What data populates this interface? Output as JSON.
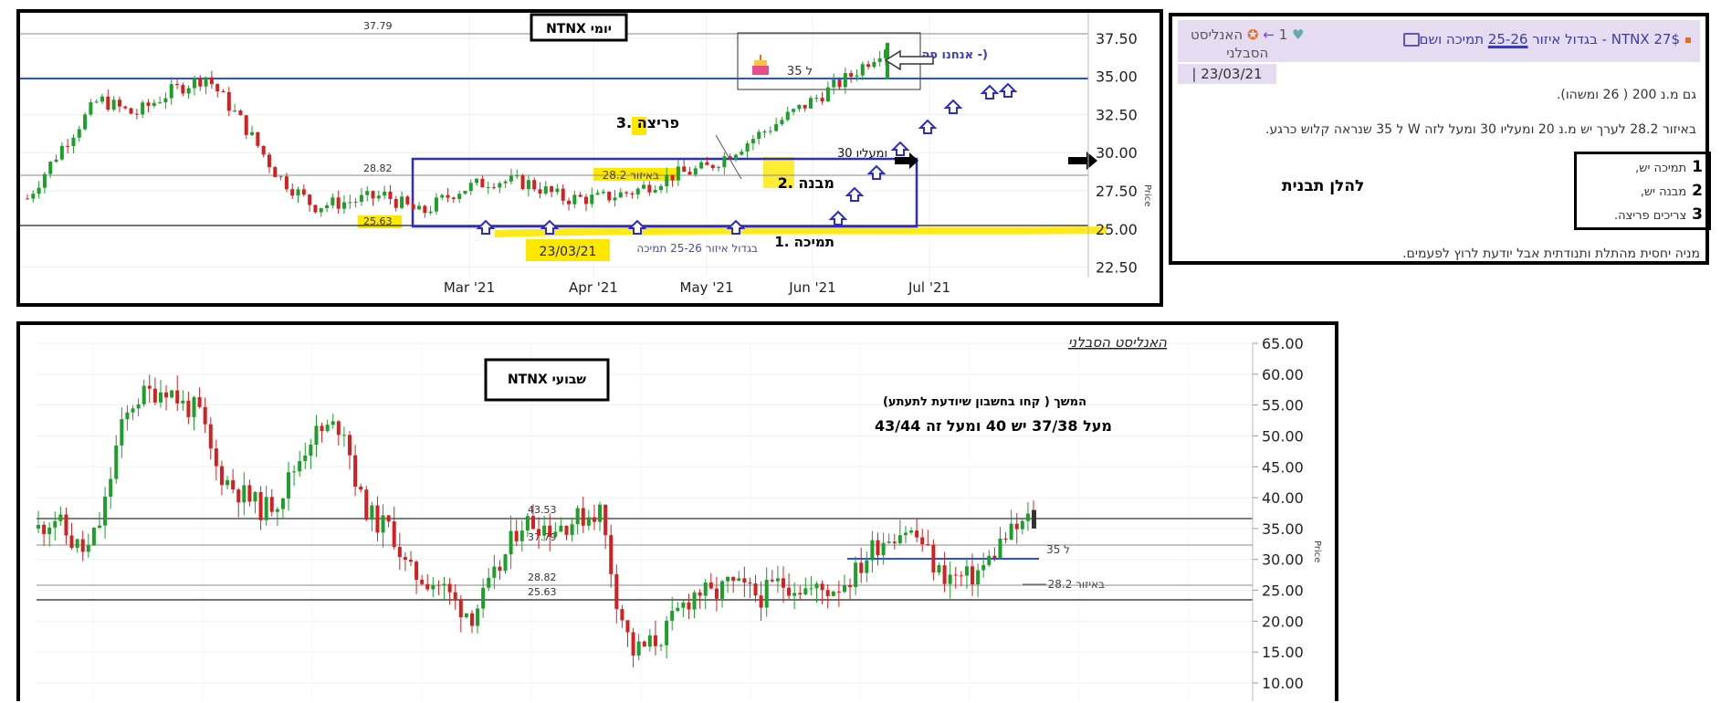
{
  "daily": {
    "title": "NTNX יומי",
    "y_ticks": [
      "37.50",
      "35.00",
      "32.50",
      "30.00",
      "27.50",
      "25.00",
      "22.50"
    ],
    "x_ticks": [
      "Mar '21",
      "Apr '21",
      "May '21",
      "Jun '21",
      "Jul '21"
    ],
    "ref_levels": [
      "37.79",
      "28.82",
      "25.63"
    ],
    "labels": {
      "breakout": "3. פריצה",
      "pattern": "2. מבנה",
      "support": "1. תמיכה",
      "here": "אנחנו פה -)",
      "to35": "ל 35",
      "above30": "ומעליו 30",
      "zone282": "באיזור 28.2",
      "zone_support": "בגדול איזור 25-26 תמיכה",
      "date": "23/03/21",
      "price_axis": "Price"
    },
    "colors": {
      "up": "#1e9e2a",
      "down": "#d42020",
      "level": "#2b50e8",
      "highlight": "#ffe800",
      "box": "#2b2bd0"
    },
    "chart_data": {
      "type": "candlestick",
      "x": [
        "2021-02-01",
        "2021-02-05",
        "2021-02-10",
        "2021-02-15",
        "2021-02-20",
        "2021-02-25",
        "2021-03-01",
        "2021-03-05",
        "2021-03-10",
        "2021-03-15",
        "2021-03-20",
        "2021-03-25",
        "2021-04-01",
        "2021-04-07",
        "2021-04-14",
        "2021-04-21",
        "2021-04-28",
        "2021-05-05",
        "2021-05-12",
        "2021-05-19",
        "2021-05-26",
        "2021-06-02",
        "2021-06-09",
        "2021-06-16",
        "2021-06-21"
      ],
      "close": [
        27.0,
        30.5,
        33.5,
        32.5,
        34.0,
        35.0,
        32.0,
        28.5,
        26.5,
        26.8,
        27.2,
        26.0,
        27.5,
        28.2,
        28.0,
        27.0,
        27.0,
        27.5,
        28.5,
        29.0,
        30.5,
        32.0,
        33.5,
        35.0,
        37.0
      ],
      "ylim": [
        22.5,
        38.5
      ],
      "xlabel": "",
      "ylabel": "Price"
    }
  },
  "weekly": {
    "title": "NTNX שבועי",
    "signature": "האנליסט הסבלני",
    "y_ticks": [
      "65.00",
      "60.00",
      "55.00",
      "50.00",
      "45.00",
      "40.00",
      "35.00",
      "30.00",
      "25.00",
      "20.00",
      "15.00",
      "10.00"
    ],
    "ref_levels": [
      "43.53",
      "37.79",
      "28.82",
      "25.63"
    ],
    "labels": {
      "continue": "המשך  ( קחו בחשבון שיודעת לתעתע)",
      "targets": "מעל  37/38  יש 40 ומעל זה 43/44",
      "to35": "ל 35",
      "zone282": "באיזור 28.2",
      "price_axis": "Price"
    },
    "chart_data": {
      "type": "candlestick",
      "close": [
        35,
        37,
        33,
        31,
        37,
        50,
        56,
        57,
        58,
        55,
        54,
        45,
        42,
        40,
        38,
        40,
        45,
        50,
        51,
        52,
        40,
        36,
        35,
        28,
        27,
        26,
        23,
        21,
        25,
        30,
        36,
        36,
        35,
        36,
        37,
        38,
        24,
        15,
        16,
        18,
        22,
        25,
        24,
        26,
        25,
        24,
        26,
        26,
        25,
        25,
        26,
        28,
        32,
        34,
        35,
        33,
        28,
        27,
        27,
        29,
        33,
        35,
        37
      ],
      "ylim": [
        8,
        67
      ],
      "xlabel": "",
      "ylabel": "Price"
    }
  },
  "post": {
    "title_pre": "NTNX 27$ - בגדול איזור ",
    "title_hl": "25-26",
    "title_post": " תמיכה ושם",
    "author_line1": "האנליסט",
    "author_line2": "הסבלני",
    "likes": "1",
    "date": "23/03/21 |",
    "line1": "גם מ.נ 200 ( 26 ומשהו).",
    "line2": "באיזור 28.2 לערך יש מ.נ 20 ומעליו 30 ומעל לזה W ל 35 שנראה קלוש כרגע.",
    "heading": "להלן תבנית",
    "list": [
      {
        "num": "1",
        "text": "תמיכה יש,"
      },
      {
        "num": "2",
        "text": "מבנה יש,"
      },
      {
        "num": "3",
        "text": "צריכים פריצה."
      }
    ],
    "footer": "מניה יחסית מהתלת ותנודתית אבל יודעת לרוץ לפעמים."
  }
}
